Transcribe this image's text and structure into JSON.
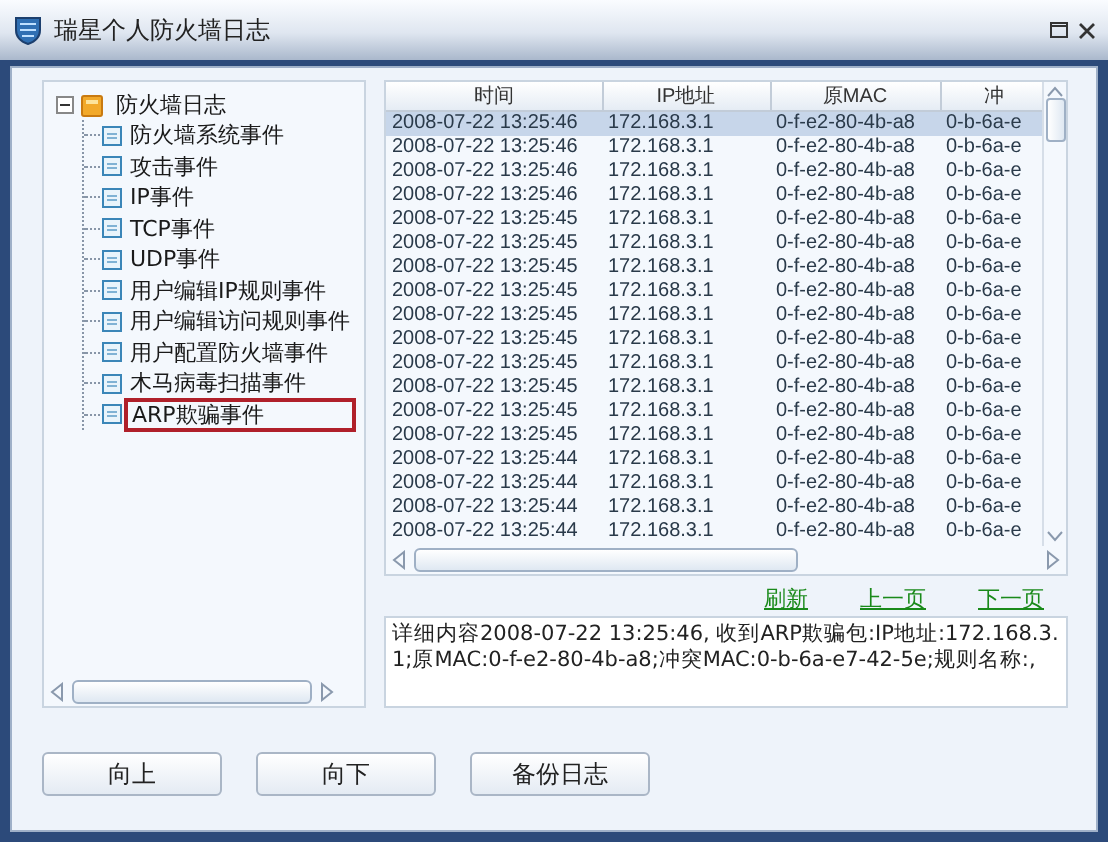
{
  "window": {
    "title": "瑞星个人防火墙日志"
  },
  "tree": {
    "label": "防火墙日志",
    "expanded": true,
    "children": [
      {
        "label": "防火墙系统事件",
        "selected": false
      },
      {
        "label": "攻击事件",
        "selected": false
      },
      {
        "label": "IP事件",
        "selected": false
      },
      {
        "label": "TCP事件",
        "selected": false
      },
      {
        "label": "UDP事件",
        "selected": false
      },
      {
        "label": "用户编辑IP规则事件",
        "selected": false
      },
      {
        "label": "用户编辑访问规则事件",
        "selected": false
      },
      {
        "label": "用户配置防火墙事件",
        "selected": false
      },
      {
        "label": "木马病毒扫描事件",
        "selected": false
      },
      {
        "label": "ARP欺骗事件",
        "selected": true
      }
    ]
  },
  "table": {
    "columns": [
      "时间",
      "IP地址",
      "原MAC",
      "冲"
    ],
    "rows": [
      {
        "cells": [
          "2008-07-22 13:25:46",
          "172.168.3.1",
          "0-f-e2-80-4b-a8",
          "0-b-6a-e"
        ],
        "selected": true
      },
      {
        "cells": [
          "2008-07-22 13:25:46",
          "172.168.3.1",
          "0-f-e2-80-4b-a8",
          "0-b-6a-e"
        ],
        "selected": false
      },
      {
        "cells": [
          "2008-07-22 13:25:46",
          "172.168.3.1",
          "0-f-e2-80-4b-a8",
          "0-b-6a-e"
        ],
        "selected": false
      },
      {
        "cells": [
          "2008-07-22 13:25:46",
          "172.168.3.1",
          "0-f-e2-80-4b-a8",
          "0-b-6a-e"
        ],
        "selected": false
      },
      {
        "cells": [
          "2008-07-22 13:25:45",
          "172.168.3.1",
          "0-f-e2-80-4b-a8",
          "0-b-6a-e"
        ],
        "selected": false
      },
      {
        "cells": [
          "2008-07-22 13:25:45",
          "172.168.3.1",
          "0-f-e2-80-4b-a8",
          "0-b-6a-e"
        ],
        "selected": false
      },
      {
        "cells": [
          "2008-07-22 13:25:45",
          "172.168.3.1",
          "0-f-e2-80-4b-a8",
          "0-b-6a-e"
        ],
        "selected": false
      },
      {
        "cells": [
          "2008-07-22 13:25:45",
          "172.168.3.1",
          "0-f-e2-80-4b-a8",
          "0-b-6a-e"
        ],
        "selected": false
      },
      {
        "cells": [
          "2008-07-22 13:25:45",
          "172.168.3.1",
          "0-f-e2-80-4b-a8",
          "0-b-6a-e"
        ],
        "selected": false
      },
      {
        "cells": [
          "2008-07-22 13:25:45",
          "172.168.3.1",
          "0-f-e2-80-4b-a8",
          "0-b-6a-e"
        ],
        "selected": false
      },
      {
        "cells": [
          "2008-07-22 13:25:45",
          "172.168.3.1",
          "0-f-e2-80-4b-a8",
          "0-b-6a-e"
        ],
        "selected": false
      },
      {
        "cells": [
          "2008-07-22 13:25:45",
          "172.168.3.1",
          "0-f-e2-80-4b-a8",
          "0-b-6a-e"
        ],
        "selected": false
      },
      {
        "cells": [
          "2008-07-22 13:25:45",
          "172.168.3.1",
          "0-f-e2-80-4b-a8",
          "0-b-6a-e"
        ],
        "selected": false
      },
      {
        "cells": [
          "2008-07-22 13:25:45",
          "172.168.3.1",
          "0-f-e2-80-4b-a8",
          "0-b-6a-e"
        ],
        "selected": false
      },
      {
        "cells": [
          "2008-07-22 13:25:44",
          "172.168.3.1",
          "0-f-e2-80-4b-a8",
          "0-b-6a-e"
        ],
        "selected": false
      },
      {
        "cells": [
          "2008-07-22 13:25:44",
          "172.168.3.1",
          "0-f-e2-80-4b-a8",
          "0-b-6a-e"
        ],
        "selected": false
      },
      {
        "cells": [
          "2008-07-22 13:25:44",
          "172.168.3.1",
          "0-f-e2-80-4b-a8",
          "0-b-6a-e"
        ],
        "selected": false
      },
      {
        "cells": [
          "2008-07-22 13:25:44",
          "172.168.3.1",
          "0-f-e2-80-4b-a8",
          "0-b-6a-e"
        ],
        "selected": false
      }
    ]
  },
  "pager": [
    "刷新",
    "上一页",
    "下一页"
  ],
  "detail": "详细内容2008-07-22 13:25:46, 收到ARP欺骗包:IP地址:172.168.3.1;原MAC:0-f-e2-80-4b-a8;冲突MAC:0-b-6a-e7-42-5e;规则名称:,",
  "buttons": [
    {
      "label": "向上"
    },
    {
      "label": "向下"
    },
    {
      "label": "备份日志"
    }
  ]
}
